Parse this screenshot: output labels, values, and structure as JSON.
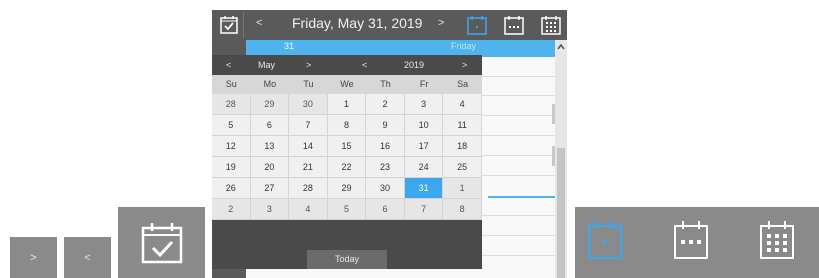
{
  "left_controls": {
    "next_label": ">",
    "prev_label": "<"
  },
  "topbar": {
    "prev_label": "<",
    "title": "Friday, May 31, 2019",
    "next_label": ">"
  },
  "dayview": {
    "day_number": "31",
    "day_name": "Friday"
  },
  "dropdown": {
    "month_prev": "<",
    "month": "May",
    "month_next": ">",
    "year_prev": "<",
    "year": "2019",
    "year_next": ">",
    "weekdays": [
      "Su",
      "Mo",
      "Tu",
      "We",
      "Th",
      "Fr",
      "Sa"
    ],
    "weeks": [
      [
        "28",
        "29",
        "30",
        "1",
        "2",
        "3",
        "4"
      ],
      [
        "5",
        "6",
        "7",
        "8",
        "9",
        "10",
        "11"
      ],
      [
        "12",
        "13",
        "14",
        "15",
        "16",
        "17",
        "18"
      ],
      [
        "19",
        "20",
        "21",
        "22",
        "23",
        "24",
        "25"
      ],
      [
        "26",
        "27",
        "28",
        "29",
        "30",
        "31",
        "1"
      ],
      [
        "2",
        "3",
        "4",
        "5",
        "6",
        "7",
        "8"
      ]
    ],
    "today_label": "Today"
  },
  "colors": {
    "accent": "#3aa7ee",
    "bar": "#5a5a5a",
    "dropdown_bg": "#4a4a4a"
  },
  "icons": [
    "calendar-check-icon",
    "calendar-day-icon",
    "calendar-week-icon",
    "calendar-month-icon",
    "scroll-up-arrow-icon"
  ]
}
